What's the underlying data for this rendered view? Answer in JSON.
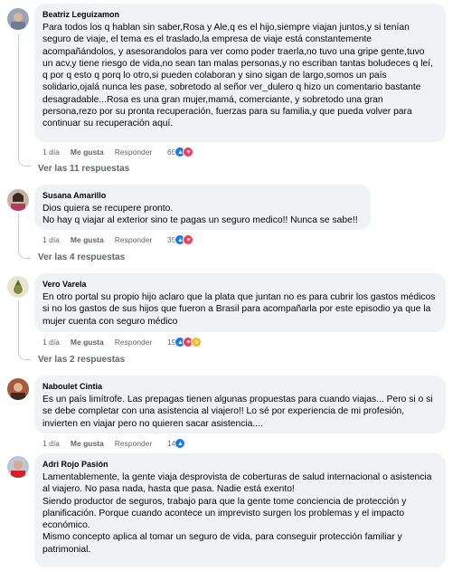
{
  "labels": {
    "like": "Me gusta",
    "reply": "Responder"
  },
  "colors": {
    "bubble": "#f0f2f5",
    "like": "#1877f2",
    "love": "#f33e58",
    "wow": "#f7b928",
    "muted": "#65676b"
  },
  "comments": [
    {
      "author": "Beatriz Leguizamon",
      "text": "Para todos los q hablan sin saber,Rosa y Ale,q es el hijo,siempre viajan juntos,y si tenían seguro de viaje, el tema es el traslado,la empresa de viaje está constantemente acompañándolos, y asesorandolos para ver como poder traerla,no tuvo una gripe gente,tuvo un acv,y tiene riesgo de vida,no sean tan malas personas,y no escriban tantas boludeces q leí, q por q esto q porq lo otro,si pueden colaboran y sino sigan de largo,somos un país solidario,ojalá nunca les pase, sobretodo al señor ver_dulero q hizo un comentario bastante desagradable...Rosa es una gran mujer,mamá, comerciante, y sobretodo una gran persona,rezo por su pronta recuperación, fuerzas para su familia,y que pueda volver para continuar su recuperación aquí.",
      "time": "1 día",
      "reactions_count": "65",
      "reactions": [
        "like",
        "love"
      ],
      "replies": "Ver las 11 respuestas"
    },
    {
      "author": "Susana Amarillo",
      "text": "Dios quiera se recupere pronto.\nNo hay q viajar al exterior sino te pagas un seguro medico!! Nunca se sabe!!",
      "time": "1 día",
      "reactions_count": "35",
      "reactions": [
        "like",
        "love"
      ],
      "replies": "Ver las 4 respuestas"
    },
    {
      "author": "Vero Varela",
      "text": "En otro portal su propio hijo aclaro que la plata que juntan no es para cubrir los gastos médicos si no los gastos de sus hijos que fueron a Brasil para acompañarla por este episodio ya que la mujer cuenta con seguro médico",
      "time": "1 día",
      "reactions_count": "19",
      "reactions": [
        "like",
        "love",
        "wow"
      ],
      "replies": "Ver las 2 respuestas"
    },
    {
      "author": "Naboulet Cintia",
      "text": "Es un país limítrofe. Las prepagas tienen algunas propuestas para cuando viajas... Pero si o si se debe completar con una asistencia al viajero!! Lo sé por experiencia de mi profesión, invierten en viajar pero no quieren sacar asistencia....",
      "time": "1 día",
      "reactions_count": "14",
      "reactions": [
        "like"
      ]
    },
    {
      "author": "Adri Rojo Pasión",
      "text": "Lamentablemente, la gente viaja desprovista de coberturas de salud internacional o asistencia al viajero. No pasa nada, hasta que pasa. Nadie está exento!\nSiendo productor de seguros, trabajo para que la gente tome conciencia de protección y planificación. Porque cuando acontece un imprevisto surgen los problemas y el impacto económico.\nMismo concepto aplica al tomar un seguro de vida, para conseguir protección familiar y patrimonial."
    }
  ]
}
